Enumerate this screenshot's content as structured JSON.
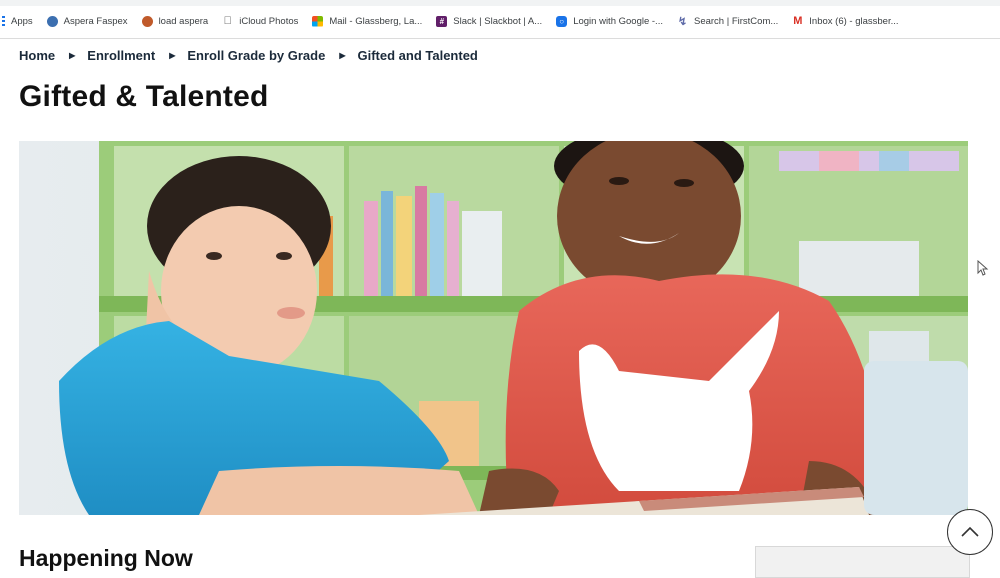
{
  "bookmarks": [
    {
      "label": "Apps",
      "icon": "apps-grid-icon",
      "color": "#1a73e8"
    },
    {
      "label": "Aspera Faspex",
      "icon": "aspera-icon",
      "color": "#3c6fb0"
    },
    {
      "label": "load aspera",
      "icon": "aspera-load-icon",
      "color": "#c05a2a"
    },
    {
      "label": "iCloud Photos",
      "icon": "apple-icon",
      "color": "#555555"
    },
    {
      "label": "Mail - Glassberg, La...",
      "icon": "outlook-icon",
      "color": "#0078d4"
    },
    {
      "label": "Slack | Slackbot | A...",
      "icon": "slack-icon",
      "color": "#611f69"
    },
    {
      "label": "Login with Google -...",
      "icon": "login-icon",
      "color": "#1a73e8"
    },
    {
      "label": "Search | FirstCom...",
      "icon": "firstcom-icon",
      "color": "#5f6ba8"
    },
    {
      "label": "Inbox (6) - glassber...",
      "icon": "gmail-icon",
      "color": "#d93025"
    }
  ],
  "breadcrumb": {
    "items": [
      "Home",
      "Enrollment",
      "Enroll Grade by Grade"
    ],
    "current": "Gifted and Talented"
  },
  "page": {
    "title": "Gifted & Talented",
    "subheading": "Happening Now"
  },
  "hero": {
    "icon": "children-reading-photo"
  },
  "colors": {
    "breadcrumb_text": "#1b2a3a",
    "title_text": "#111111",
    "shelf_green": "#8cc26a",
    "shirt_blue": "#2aa6d8",
    "shirt_red": "#e05a4a"
  }
}
